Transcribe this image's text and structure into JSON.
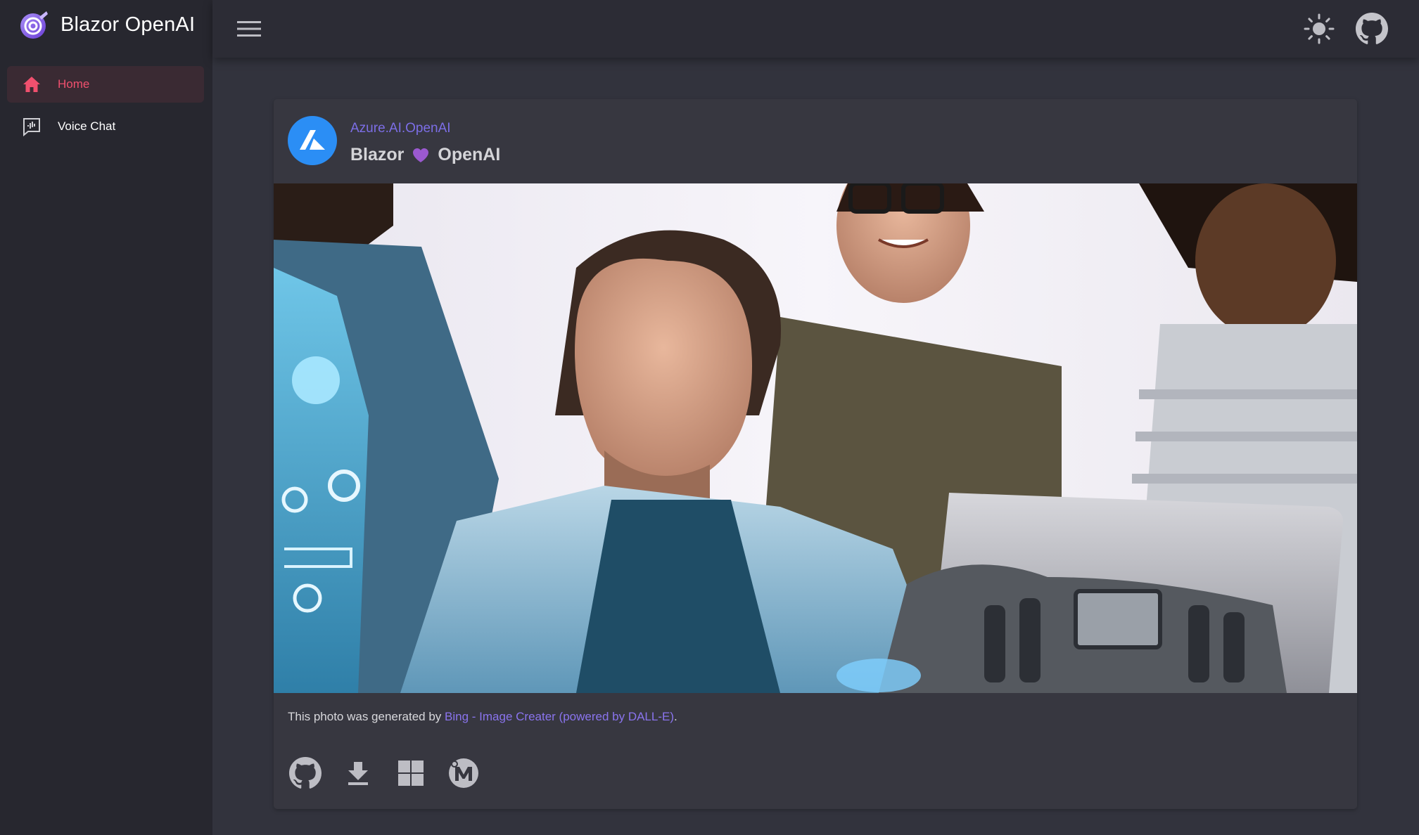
{
  "app": {
    "title": "Blazor OpenAI"
  },
  "sidebar": {
    "items": [
      {
        "label": "Home",
        "icon": "home-icon",
        "active": true
      },
      {
        "label": "Voice Chat",
        "icon": "voice-chat-icon",
        "active": false
      }
    ]
  },
  "appbar": {
    "menu_icon": "menu-icon",
    "theme_icon": "sun-icon",
    "github_icon": "github-icon"
  },
  "card": {
    "subtitle": "Azure.AI.OpenAI",
    "title_left": "Blazor",
    "title_right": "OpenAI",
    "heart_icon": "purple-heart-icon",
    "avatar_icon": "azure-logo-icon",
    "image_description_alt": "",
    "caption_prefix": "This photo was generated by ",
    "caption_link": "Bing - Image Creater (powered by DALL-E)",
    "caption_suffix": ".",
    "actions": [
      {
        "icon": "github-icon"
      },
      {
        "icon": "download-icon"
      },
      {
        "icon": "windows-icon"
      },
      {
        "icon": "microsoft-store-icon"
      }
    ]
  },
  "colors": {
    "accent": "#f0506e",
    "link": "#8a74ee",
    "azure_blue": "#2b8ef5"
  }
}
